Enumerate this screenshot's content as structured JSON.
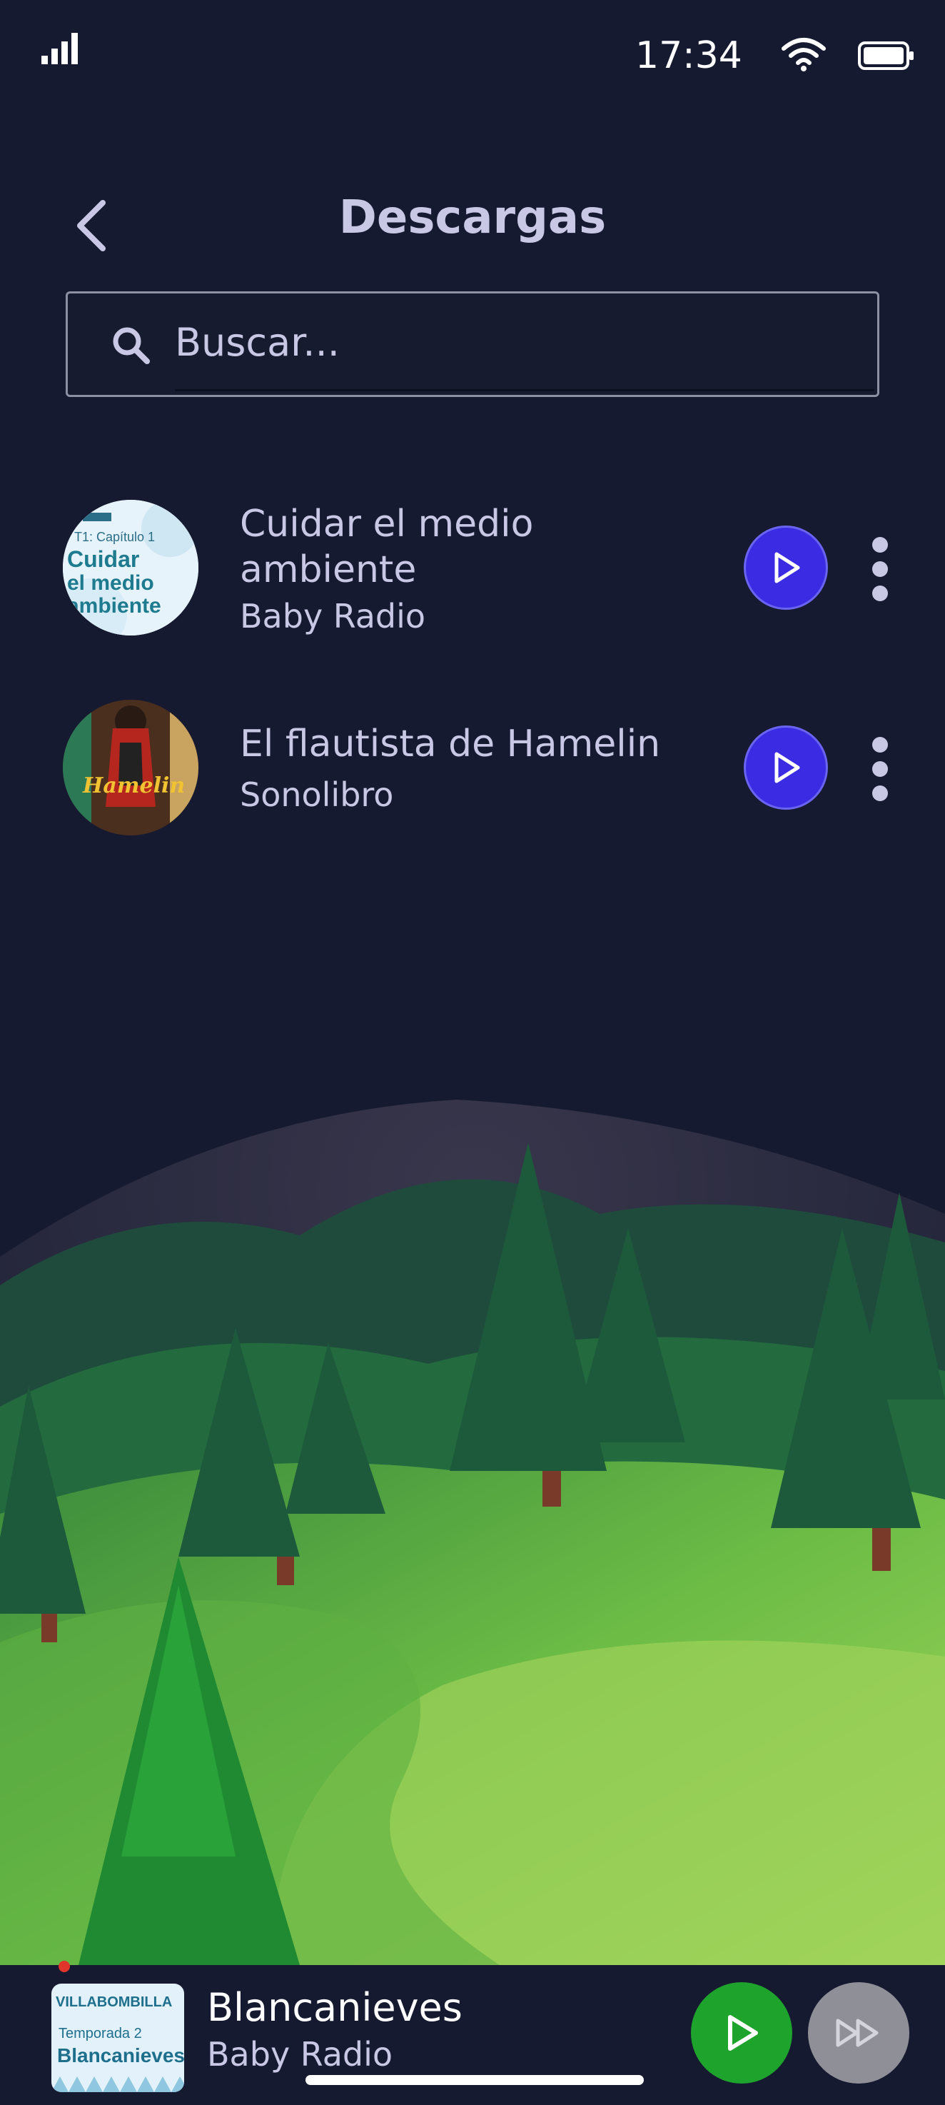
{
  "status": {
    "time": "17:34"
  },
  "header": {
    "title": "Descargas"
  },
  "search": {
    "placeholder": "Buscar..."
  },
  "downloads": [
    {
      "title_line1": "Cuidar el medio",
      "title_line2": "ambiente",
      "subtitle": "Baby Radio",
      "thumb": {
        "top": "T1: Capítulo 1",
        "l1": "Cuidar",
        "l2": "el medio",
        "l3": "ambiente"
      }
    },
    {
      "title": "El flautista de Hamelin",
      "subtitle": "Sonolibro",
      "thumb": {
        "text": "Hamelin"
      }
    }
  ],
  "mini_player": {
    "title": "Blancanieves",
    "subtitle": "Baby Radio",
    "thumb": {
      "brand": "VILLABOMBILLA",
      "season": "Temporada 2",
      "name": "Blancanieves"
    }
  },
  "colors": {
    "background": "#161a30",
    "accent": "#3b2ce4",
    "play_green": "#1ea42c"
  }
}
